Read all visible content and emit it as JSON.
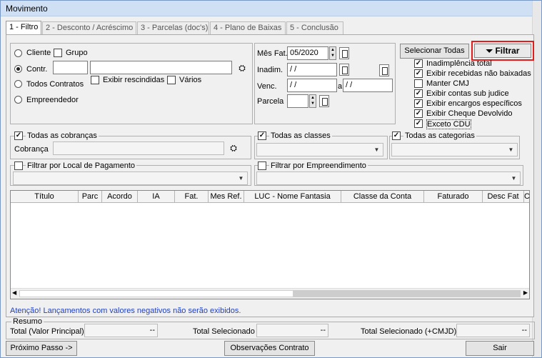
{
  "window": {
    "title": "Movimento"
  },
  "tabs": [
    {
      "label": "1 - Filtro"
    },
    {
      "label": "2 - Desconto / Acréscimo"
    },
    {
      "label": "3 - Parcelas (doc's)"
    },
    {
      "label": "4 - Plano de Baixas"
    },
    {
      "label": "5 - Conclusão"
    }
  ],
  "filter": {
    "radio_cliente": "Cliente",
    "chk_grupo": "Grupo",
    "radio_contr": "Contr.",
    "radio_todos_contratos": "Todos Contratos",
    "chk_exibir_rescindidas": "Exibir rescindidas",
    "chk_varios": "Vários",
    "radio_empreendedor": "Empreendedor",
    "mes_fat_label": "Mês Fat.",
    "mes_fat_value": "05/2020",
    "inadim_label": "Inadim.",
    "inadim_value": " / /",
    "venc_label": "Venc.",
    "venc_from": " / /",
    "venc_sep": "a",
    "venc_to": " / /",
    "parcela_label": "Parcela"
  },
  "options": {
    "select_all_label": "Selecionar Todas",
    "filter_button_label": "Filtrar",
    "checkboxes": [
      {
        "label": "Inadimplência total",
        "checked": true
      },
      {
        "label": "Exibir recebidas não baixadas",
        "checked": true
      },
      {
        "label": "Manter CMJ",
        "checked": false
      },
      {
        "label": "Exibir contas sub judice",
        "checked": true
      },
      {
        "label": "Exibir encargos específicos",
        "checked": true
      },
      {
        "label": "Exibir Cheque Devolvido",
        "checked": true
      },
      {
        "label": "Exceto CDU",
        "checked": true
      }
    ]
  },
  "cobrancas": {
    "all_label": "Todas as cobranças",
    "cobranca_label": "Cobrança",
    "classes_label": "Todas as classes",
    "categorias_label": "Todas as categorias"
  },
  "local_pagamento": {
    "label": "Filtrar por Local de Pagamento"
  },
  "empreendimento": {
    "label": "Filtrar por Empreendimento"
  },
  "grid": {
    "columns": [
      "Título",
      "Parc",
      "Acordo",
      "IA",
      "Fat.",
      "Mes Ref.",
      "LUC - Nome Fantasia",
      "Classe da Conta",
      "Faturado",
      "Desc Fat",
      "Co"
    ]
  },
  "warning": "Atenção! Lançamentos com valores negativos não serão exibidos.",
  "resumo": {
    "title": "Resumo",
    "total_principal_label": "Total (Valor Principal)",
    "total_principal_value": "--",
    "total_selecionado_label": "Total Selecionado",
    "total_selecionado_value": "--",
    "total_cmjd_label": "Total Selecionado (+CMJD)",
    "total_cmjd_value": "--"
  },
  "footer": {
    "next_label": "Próximo Passo ->",
    "obs_label": "Observações Contrato",
    "exit_label": "Sair"
  }
}
